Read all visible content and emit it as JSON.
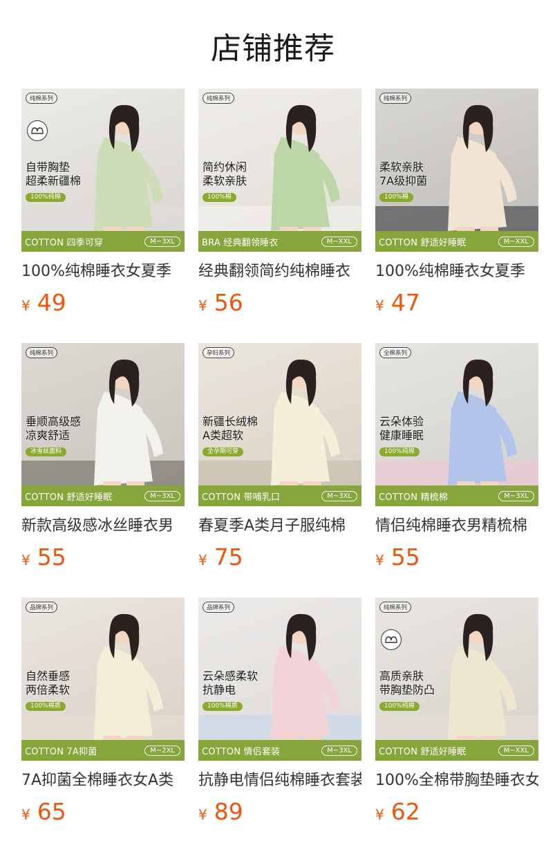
{
  "page": {
    "title": "店铺推荐"
  },
  "colors": {
    "price": "#f2540c",
    "strip_green": "#86a53a",
    "pill_green": "#8aa92e"
  },
  "products": [
    {
      "series": "纯棉系列",
      "has_bra_icon": true,
      "headline_1": "自带胸垫",
      "headline_2": "超柔新疆棉",
      "pill": "100%纯棉",
      "strip": "COTTON 四季可穿",
      "size": "M~3XL",
      "title": "100%纯棉睡衣女夏季",
      "currency": "¥",
      "price": "49",
      "palette": {
        "bg1": "#ecebe7",
        "bg2": "#d8d4cf",
        "cloth": "#cfdcb8",
        "sofa": "#e0ddd8"
      }
    },
    {
      "series": "纯棉系列",
      "has_bra_icon": false,
      "headline_1": "简约休闲",
      "headline_2": "柔软亲肤",
      "pill": "100%棉",
      "strip": "BRA 经典翻领睡衣",
      "size": "M~XXL",
      "title": "经典翻领简约纯棉睡衣",
      "currency": "¥",
      "price": "56",
      "palette": {
        "bg1": "#efede9",
        "bg2": "#e1ddd6",
        "cloth": "#bcd6a7",
        "sofa": "#f1efe9"
      }
    },
    {
      "series": "纯棉系列",
      "has_bra_icon": false,
      "headline_1": "柔软亲肤",
      "headline_2": "7A级抑菌",
      "pill": "100%棉",
      "strip": "COTTON 舒适好睡眠",
      "size": "M~XXL",
      "title": "100%纯棉睡衣女夏季",
      "currency": "¥",
      "price": "47",
      "palette": {
        "bg1": "#d9d7d4",
        "bg2": "#bdbab6",
        "cloth": "#f0e4d2",
        "sofa": "#4f5054"
      }
    },
    {
      "series": "纯棉系列",
      "has_bra_icon": false,
      "headline_1": "垂顺高级感",
      "headline_2": "凉爽舒适",
      "pill": "冰雪丝面料",
      "strip": "COTTON 舒适好睡眠",
      "size": "M~3XL",
      "title": "新款高级感冰丝睡衣男",
      "currency": "¥",
      "price": "55",
      "palette": {
        "bg1": "#dcd9d3",
        "bg2": "#c8c4bc",
        "cloth": "#f2f1ec",
        "sofa": "#7b776f"
      }
    },
    {
      "series": "孕妇系列",
      "has_bra_icon": false,
      "headline_1": "新疆长绒棉",
      "headline_2": "A类超软",
      "pill": "全孕期可穿",
      "strip": "COTTON 带哺乳口",
      "size": "M~3XL",
      "title": "春夏季A类月子服纯棉",
      "currency": "¥",
      "price": "75",
      "palette": {
        "bg1": "#ebe6dd",
        "bg2": "#d8d0c3",
        "cloth": "#f4efd8",
        "sofa": "#c8bfae"
      }
    },
    {
      "series": "全棉系列",
      "has_bra_icon": false,
      "headline_1": "云朵体验",
      "headline_2": "健康睡眠",
      "pill": "100%纯棉",
      "strip": "COTTON 精梳棉",
      "size": "M~3XL",
      "title": "情侣纯棉睡衣男精梳棉",
      "currency": "¥",
      "price": "55",
      "palette": {
        "bg1": "#e6e5e2",
        "bg2": "#d2d0cc",
        "cloth": "#b2c4ea",
        "sofa": "#ecc9d3"
      }
    },
    {
      "series": "品牌系列",
      "has_bra_icon": false,
      "headline_1": "自然垂感",
      "headline_2": "两倍柔软",
      "pill": "100%棉质",
      "strip": "COTTON 7A抑菌",
      "size": "M~2XL",
      "title": "7A抑菌全棉睡衣女A类",
      "currency": "¥",
      "price": "65",
      "palette": {
        "bg1": "#ebe6e0",
        "bg2": "#d8d0c6",
        "cloth": "#f3ecd7",
        "sofa": "#e6ddd1"
      }
    },
    {
      "series": "品牌系列",
      "has_bra_icon": false,
      "headline_1": "云朵感柔软",
      "headline_2": "抗静电",
      "pill": "100%棉质",
      "strip": "COTTON 情侣套装",
      "size": "M~3XL",
      "title": "抗静电情侣纯棉睡衣套装",
      "currency": "¥",
      "price": "89",
      "palette": {
        "bg1": "#eceae8",
        "bg2": "#dedbd8",
        "cloth": "#f1d3d8",
        "sofa": "#c9d9ea"
      }
    },
    {
      "series": "纯棉系列",
      "has_bra_icon": true,
      "headline_1": "高质亲肤",
      "headline_2": "带胸垫防凸",
      "pill": "100%纯棉",
      "strip": "COTTON 舒适好睡眠",
      "size": "M~XXL",
      "title": "100%全棉带胸垫睡衣女",
      "currency": "¥",
      "price": "62",
      "palette": {
        "bg1": "#e9e6e1",
        "bg2": "#d6d1ca",
        "cloth": "#efe6cf",
        "sofa": "#e3ded6"
      }
    }
  ]
}
